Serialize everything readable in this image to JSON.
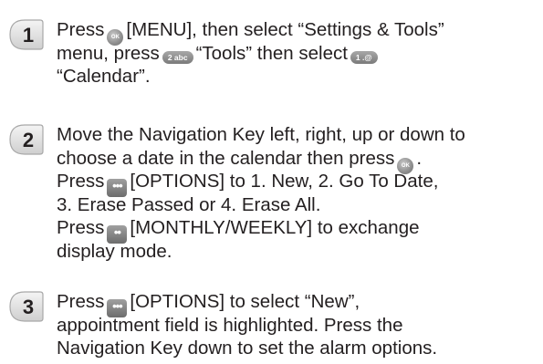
{
  "steps": [
    {
      "number": "1",
      "lines": [
        {
          "a": "Press",
          "key": "OK",
          "b": "[MENU], then select “Settings & Tools”"
        },
        {
          "a": "menu, press",
          "key": "2",
          "b": "“Tools” then select",
          "key2": "1"
        },
        {
          "a": "“Calendar”."
        }
      ]
    },
    {
      "number": "2",
      "lines": [
        {
          "a": "Move the Navigation Key left, right, up or down to"
        },
        {
          "a": "choose a date in the calendar then press",
          "key": "OK",
          "b": "."
        },
        {
          "a": "Press",
          "key": "•••",
          "b": "[OPTIONS] to 1. New, 2. Go To Date,"
        },
        {
          "a": "3. Erase Passed or 4. Erase All."
        },
        {
          "a": "Press",
          "key": "••",
          "b": "[MONTHLY/WEEKLY] to exchange"
        },
        {
          "a": "display mode."
        }
      ]
    },
    {
      "number": "3",
      "lines": [
        {
          "a": "Press",
          "key": "•••",
          "b": "[OPTIONS] to select “New”,"
        },
        {
          "a": "appointment field is highlighted. Press the"
        },
        {
          "a": "Navigation Key down to set the alarm options."
        }
      ]
    }
  ],
  "key_labels": {
    "ok": "OK",
    "two": "2 abc",
    "one": "1 .@"
  },
  "colors": {
    "badge_light": "#ededed",
    "badge_dark": "#9a9a9a",
    "text": "#231f20",
    "key_gray": "#8c8c8c"
  }
}
